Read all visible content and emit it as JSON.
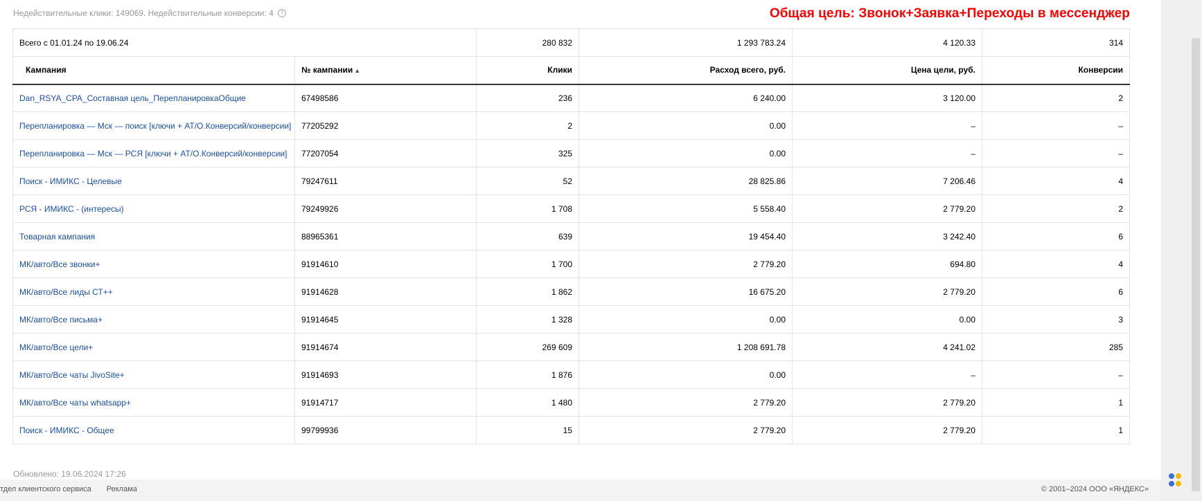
{
  "top_note": "Недействительные клики: 149069. Недействительные конверсии: 4",
  "goal_title": "Общая цель: Звонок+Заявка+Переходы в мессенджер",
  "total_row": {
    "label": "Всего с 01.01.24 по 19.06.24",
    "clicks": "280 832",
    "spend": "1 293 783.24",
    "goal_price": "4 120.33",
    "conversions": "314"
  },
  "headers": {
    "campaign": "Кампания",
    "campaign_id": "№ кампании",
    "clicks": "Клики",
    "spend": "Расход всего, руб.",
    "goal_price": "Цена цели, руб.",
    "conversions": "Конверсии"
  },
  "rows": [
    {
      "name": "Dan_RSYA_CPA_Составная цель_ПерепланировкаОбщие",
      "id": "67498586",
      "clicks": "236",
      "spend": "6 240.00",
      "goal_price": "3 120.00",
      "conversions": "2"
    },
    {
      "name": "Перепланировка — Мск — поиск [ключи + АТ/О.Конверсий/конверсии]",
      "id": "77205292",
      "clicks": "2",
      "spend": "0.00",
      "goal_price": "–",
      "conversions": "–"
    },
    {
      "name": "Перепланировка — Мск — РСЯ [ключи + АТ/О.Конверсий/конверсии]",
      "id": "77207054",
      "clicks": "325",
      "spend": "0.00",
      "goal_price": "–",
      "conversions": "–"
    },
    {
      "name": "Поиск - ИМИКС - Целевые",
      "id": "79247611",
      "clicks": "52",
      "spend": "28 825.86",
      "goal_price": "7 206.46",
      "conversions": "4"
    },
    {
      "name": "РСЯ - ИМИКС - (интересы)",
      "id": "79249926",
      "clicks": "1 708",
      "spend": "5 558.40",
      "goal_price": "2 779.20",
      "conversions": "2"
    },
    {
      "name": "Товарная кампания",
      "id": "88965361",
      "clicks": "639",
      "spend": "19 454.40",
      "goal_price": "3 242.40",
      "conversions": "6"
    },
    {
      "name": "МК/авто/Все звонки+",
      "id": "91914610",
      "clicks": "1 700",
      "spend": "2 779.20",
      "goal_price": "694.80",
      "conversions": "4"
    },
    {
      "name": "МК/авто/Все лиды СТ++",
      "id": "91914628",
      "clicks": "1 862",
      "spend": "16 675.20",
      "goal_price": "2 779.20",
      "conversions": "6"
    },
    {
      "name": "МК/авто/Все письма+",
      "id": "91914645",
      "clicks": "1 328",
      "spend": "0.00",
      "goal_price": "0.00",
      "conversions": "3"
    },
    {
      "name": "МК/авто/Все цели+",
      "id": "91914674",
      "clicks": "269 609",
      "spend": "1 208 691.78",
      "goal_price": "4 241.02",
      "conversions": "285"
    },
    {
      "name": "МК/авто/Все чаты JivoSite+",
      "id": "91914693",
      "clicks": "1 876",
      "spend": "0.00",
      "goal_price": "–",
      "conversions": "–"
    },
    {
      "name": "МК/авто/Все чаты whatsapp+",
      "id": "91914717",
      "clicks": "1 480",
      "spend": "2 779.20",
      "goal_price": "2 779.20",
      "conversions": "1"
    },
    {
      "name": "Поиск - ИМИКС - Общее",
      "id": "99799936",
      "clicks": "15",
      "spend": "2 779.20",
      "goal_price": "2 779.20",
      "conversions": "1"
    }
  ],
  "updated": "Обновлено: 19.06.2024 17:26",
  "footer": {
    "links": [
      "тдел клиентского сервиса",
      "Реклама"
    ],
    "copyright": "© 2001–2024 ООО «ЯНДЕКС»"
  },
  "colors": {
    "goal_title": "#ff0000",
    "link": "#1a4fa8",
    "muted": "#999999"
  }
}
